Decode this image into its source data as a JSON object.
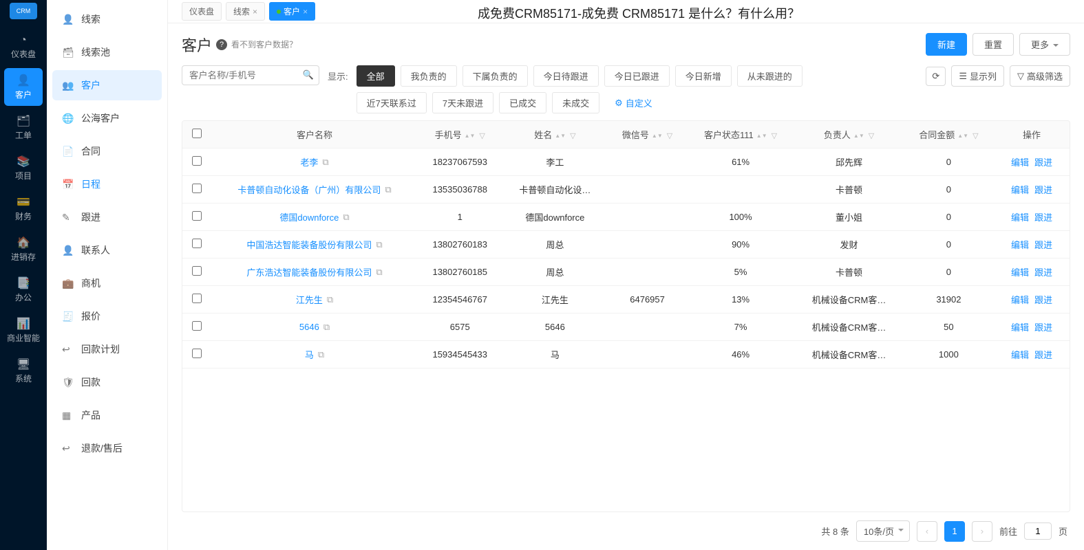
{
  "logo": "CRM",
  "overlay_title": "成免费CRM85171-成免费 CRM85171 是什么？有什么用？",
  "primary_nav": [
    {
      "icon": "◔",
      "label": "仪表盘"
    },
    {
      "icon": "👤",
      "label": "客户",
      "active": true
    },
    {
      "icon": "🗂",
      "label": "工单"
    },
    {
      "icon": "📚",
      "label": "项目"
    },
    {
      "icon": "💳",
      "label": "财务"
    },
    {
      "icon": "🏠",
      "label": "进销存"
    },
    {
      "icon": "📑",
      "label": "办公"
    },
    {
      "icon": "📊",
      "label": "商业智能"
    },
    {
      "icon": "🖥",
      "label": "系统"
    }
  ],
  "secondary_nav": [
    {
      "icon": "👤",
      "label": "线索"
    },
    {
      "icon": "🗃",
      "label": "线索池"
    },
    {
      "icon": "👥",
      "label": "客户",
      "active": true
    },
    {
      "icon": "🌐",
      "label": "公海客户"
    },
    {
      "icon": "📄",
      "label": "合同"
    },
    {
      "icon": "📅",
      "label": "日程",
      "color": "#1890ff"
    },
    {
      "icon": "✎",
      "label": "跟进"
    },
    {
      "icon": "👤",
      "label": "联系人"
    },
    {
      "icon": "💼",
      "label": "商机"
    },
    {
      "icon": "🧾",
      "label": "报价"
    },
    {
      "icon": "↩",
      "label": "回款计划"
    },
    {
      "icon": "🛡",
      "label": "回款"
    },
    {
      "icon": "▦",
      "label": "产品"
    },
    {
      "icon": "↩",
      "label": "退款/售后"
    }
  ],
  "tabs": [
    {
      "label": "仪表盘"
    },
    {
      "label": "线索",
      "closable": true
    },
    {
      "label": "客户",
      "active": true,
      "closable": true,
      "dot": true
    }
  ],
  "page": {
    "title": "客户",
    "help_hint": "看不到客户数据？",
    "actions": {
      "create": "新建",
      "reset": "重置",
      "more": "更多"
    }
  },
  "search": {
    "placeholder": "客户名称/手机号"
  },
  "filter_label": "显示:",
  "filters": [
    "全部",
    "我负责的",
    "下属负责的",
    "今日待跟进",
    "今日已跟进",
    "今日新增",
    "从未跟进的",
    "近7天联系过",
    "7天未跟进",
    "已成交",
    "未成交"
  ],
  "custom_filter": "自定义",
  "right_tools": {
    "refresh": "⟳",
    "columns": "显示列",
    "advanced": "高级筛选"
  },
  "columns": [
    "客户名称",
    "手机号",
    "姓名",
    "微信号",
    "客户状态111",
    "负责人",
    "合同金额",
    "操作"
  ],
  "action_labels": {
    "edit": "编辑",
    "follow": "跟进"
  },
  "rows": [
    {
      "name": "老李",
      "phone": "18237067593",
      "person": "李工",
      "wechat": "",
      "status": "61%",
      "owner": "邱先辉",
      "amount": "0"
    },
    {
      "name": "卡普顿自动化设备（广州）有限公司",
      "phone": "13535036788",
      "person": "卡普顿自动化设…",
      "wechat": "",
      "status": "",
      "owner": "卡普顿",
      "amount": "0"
    },
    {
      "name": "德国downforce",
      "phone": "1",
      "person": "德国downforce",
      "wechat": "",
      "status": "100%",
      "owner": "董小姐",
      "amount": "0"
    },
    {
      "name": "中国浩达智能装备股份有限公司",
      "phone": "13802760183",
      "person": "周总",
      "wechat": "",
      "status": "90%",
      "owner": "发财",
      "amount": "0"
    },
    {
      "name": "广东浩达智能装备股份有限公司",
      "phone": "13802760185",
      "person": "周总",
      "wechat": "",
      "status": "5%",
      "owner": "卡普顿",
      "amount": "0"
    },
    {
      "name": "江先生",
      "phone": "12354546767",
      "person": "江先生",
      "wechat": "6476957",
      "status": "13%",
      "owner": "机械设备CRM客…",
      "amount": "31902"
    },
    {
      "name": "5646",
      "phone": "6575",
      "person": "5646",
      "wechat": "",
      "status": "7%",
      "owner": "机械设备CRM客…",
      "amount": "50"
    },
    {
      "name": "马",
      "phone": "15934545433",
      "person": "马",
      "wechat": "",
      "status": "46%",
      "owner": "机械设备CRM客…",
      "amount": "1000"
    }
  ],
  "pagination": {
    "total_text": "共 8 条",
    "page_size": "10条/页",
    "current": "1",
    "goto_label": "前往",
    "goto_value": "1",
    "goto_unit": "页"
  }
}
